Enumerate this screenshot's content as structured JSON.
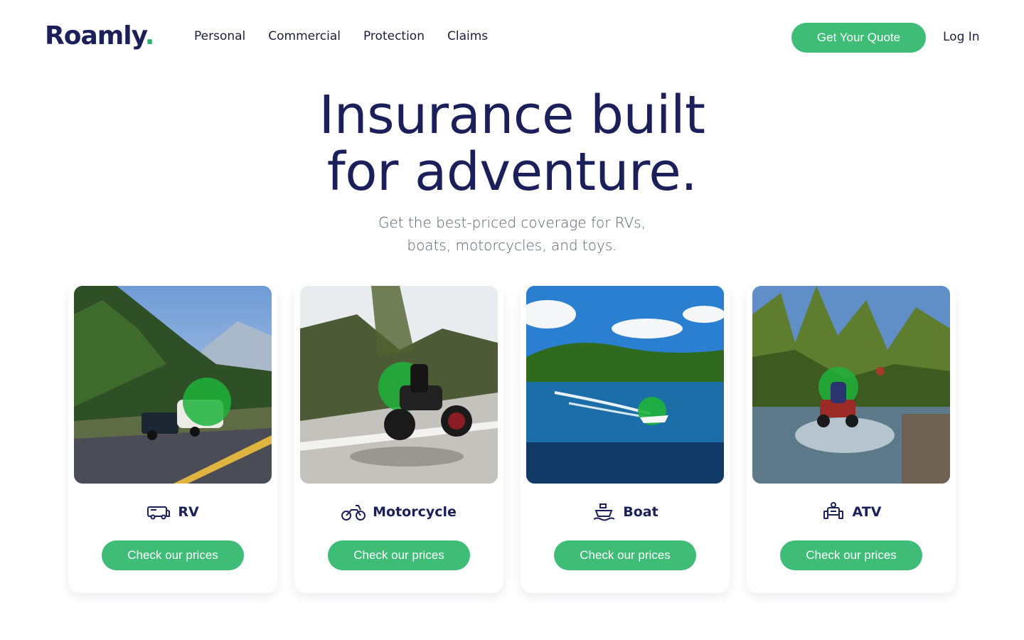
{
  "header": {
    "logo_text": "Roamly",
    "logo_dot": ".",
    "nav": [
      "Personal",
      "Commercial",
      "Protection",
      "Claims"
    ],
    "quote_label": "Get Your Quote",
    "login_label": "Log In"
  },
  "hero": {
    "title_line1": "Insurance built",
    "title_line2": "for adventure.",
    "subtitle_line1": "Get the best-priced coverage for RVs,",
    "subtitle_line2": "boats, motorcycles, and toys."
  },
  "cards": [
    {
      "label": "RV",
      "icon": "rv-icon",
      "cta": "Check our prices",
      "photo": "rv-on-mountain-road-image"
    },
    {
      "label": "Motorcycle",
      "icon": "motorcycle-icon",
      "cta": "Check our prices",
      "photo": "motorcycle-rider-image"
    },
    {
      "label": "Boat",
      "icon": "boat-icon",
      "cta": "Check our prices",
      "photo": "speedboat-on-lake-image"
    },
    {
      "label": "ATV",
      "icon": "atv-icon",
      "cta": "Check our prices",
      "photo": "atv-in-creek-image"
    }
  ],
  "colors": {
    "brand_navy": "#1b1f5a",
    "accent_green": "#3fbd76",
    "text_gray": "#5b5e6e"
  }
}
